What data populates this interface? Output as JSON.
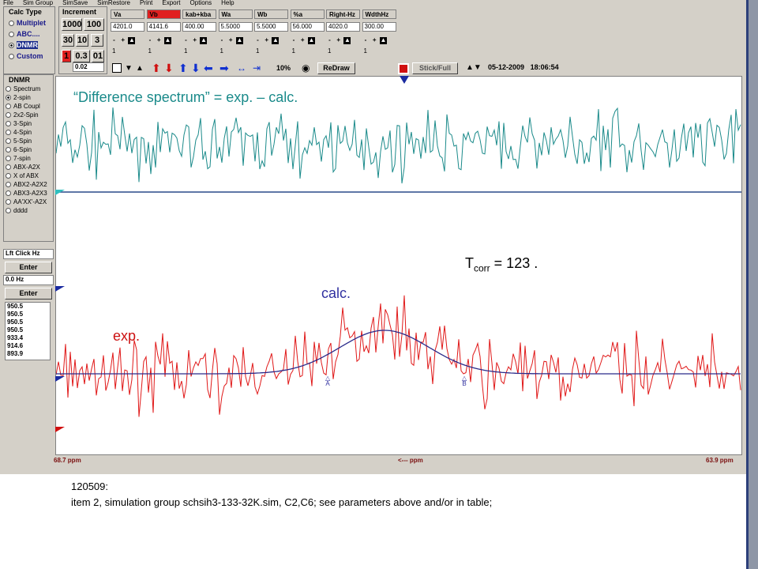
{
  "menu": [
    "File",
    "Sim Group",
    "SimSave",
    "SimRestore",
    "Print",
    "Export",
    "Options",
    "Help"
  ],
  "calc_type": {
    "title": "Calc Type",
    "options": [
      "Multiplet",
      "ABC....",
      "DNMR",
      "Custom"
    ],
    "selected": "DNMR"
  },
  "increment": {
    "title": "Increment",
    "buttons": [
      "1000",
      "100",
      "30",
      "10",
      "3",
      "1",
      "0.3",
      "01"
    ],
    "value": "0.02"
  },
  "params": [
    {
      "name": "Va",
      "value": "4201.0",
      "small": "1",
      "highlight": false
    },
    {
      "name": "Vb",
      "value": "4141.6",
      "small": "1",
      "highlight": true
    },
    {
      "name": "kab+kba",
      "value": "400.00",
      "small": "1",
      "highlight": false
    },
    {
      "name": "Wa",
      "value": "5.5000",
      "small": "1",
      "highlight": false
    },
    {
      "name": "Wb",
      "value": "5.5000",
      "small": "1",
      "highlight": false
    },
    {
      "name": "%a",
      "value": "56.000",
      "small": "1",
      "highlight": false
    },
    {
      "name": "Right-Hz",
      "value": "4020.0",
      "small": "1",
      "highlight": false
    },
    {
      "name": "WdthHz",
      "value": "300.00",
      "small": "1",
      "highlight": false
    }
  ],
  "toolbar": {
    "zoom": "10%",
    "redraw": "ReDraw",
    "stickfull": "Stick/Full",
    "date": "05-12-2009",
    "time": "18:06:54"
  },
  "dnmr": {
    "title": "DNMR",
    "options": [
      "Spectrum",
      "2-spin",
      "AB Coupl",
      "2x2-Spin",
      "3-Spin",
      "4-Spin",
      "5-Spin",
      "6-Spin",
      "7-spin",
      "ABX-A2X",
      "X of ABX",
      "ABX2-A2X2",
      "ABX3-A2X3",
      "AA'XX'-A2X",
      "dddd"
    ],
    "selected": "2-spin"
  },
  "lftclick": {
    "label": "Lft Click Hz",
    "enter1": "Enter",
    "value": "0.0 Hz",
    "enter2": "Enter"
  },
  "peak_list": [
    "950.5",
    "950.5",
    "950.5",
    "950.5",
    "933.4",
    "914.6",
    "893.9"
  ],
  "plot": {
    "difference_label": "“Difference spectrum” = exp. – calc.",
    "tcorr_T": "T",
    "tcorr_sub": "corr",
    "tcorr_rest": " = 123  .",
    "calc_label": "calc.",
    "exp_label": "exp.",
    "marker_a": "A",
    "marker_b": "B",
    "colors": {
      "diff": "#1a8a8a",
      "exp": "#e01818",
      "calc": "#2a2a8a",
      "label_blue": "#3030a0",
      "label_red": "#cc1010",
      "label_teal": "#1a8a8a"
    }
  },
  "axis": {
    "left": "68.7 ppm",
    "center": "<--- ppm",
    "right": "63.9 ppm"
  },
  "caption": {
    "line1": "120509:",
    "line2": "item 2, simulation group schsih3-133-32K.sim,  C2,C6; see parameters above and/or in table;"
  }
}
